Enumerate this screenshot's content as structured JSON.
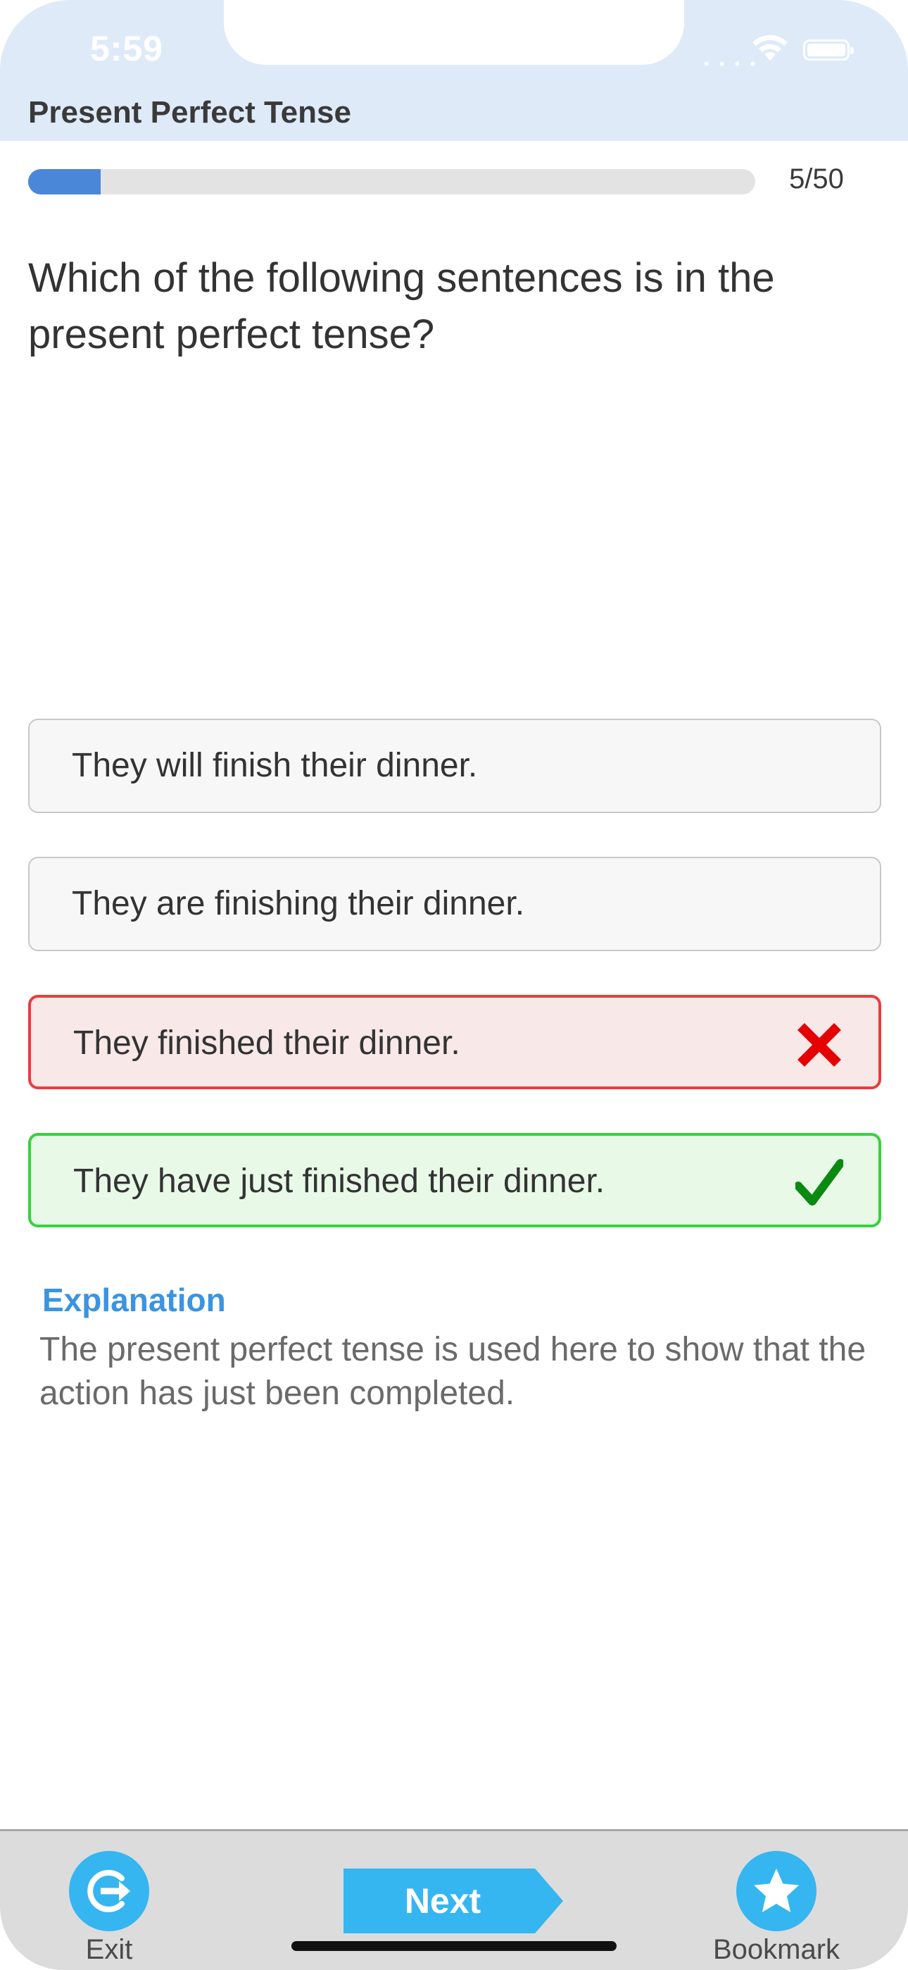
{
  "status_bar": {
    "time": "5:59",
    "signal_icon": "cellular-signal-icon",
    "wifi_icon": "wifi-icon",
    "battery_icon": "battery-icon"
  },
  "header": {
    "title": "Present Perfect Tense",
    "background_color": "#dfeaf9"
  },
  "progress": {
    "current": 5,
    "total": 50,
    "label": "5/50",
    "fill_fraction": 0.1,
    "fill_color": "#4b87d8"
  },
  "question": {
    "text": "Which of the following sentences is in the present perfect tense?"
  },
  "answers": [
    {
      "text": "They will finish their dinner.",
      "state": "neutral"
    },
    {
      "text": "They are finishing their dinner.",
      "state": "neutral"
    },
    {
      "text": "They finished their dinner.",
      "state": "wrong",
      "icon": "cross-icon",
      "color": "#ea3d3d"
    },
    {
      "text": "They have just finished their dinner.",
      "state": "correct",
      "icon": "checkmark-icon",
      "color": "#35d33a"
    }
  ],
  "explanation": {
    "title": "Explanation",
    "text": "The present perfect tense is used here to show that the action has just been completed.",
    "title_color": "#3b94e0"
  },
  "toolbar": {
    "exit_label": "Exit",
    "exit_icon": "exit-icon",
    "next_label": "Next",
    "bookmark_label": "Bookmark",
    "bookmark_icon": "star-icon",
    "accent_color": "#35b6f1"
  }
}
